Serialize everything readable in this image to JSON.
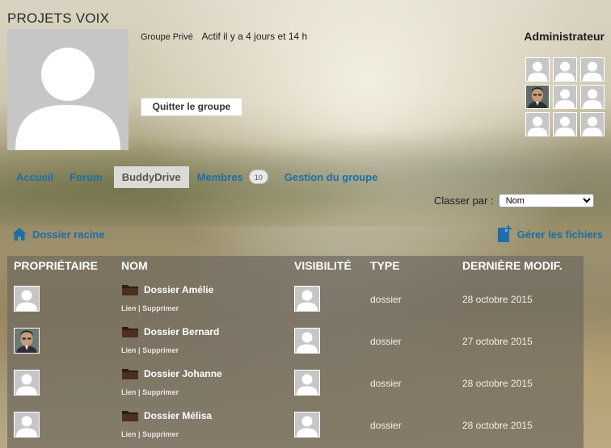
{
  "group": {
    "title": "PROJETS VOIX",
    "privacy": "Groupe Privé",
    "activity": "Actif il y a 4 jours et 14 h",
    "quit_label": "Quitter le groupe"
  },
  "admins": {
    "title": "Administrateur"
  },
  "nav": {
    "items": [
      {
        "label": "Accueil"
      },
      {
        "label": "Forum"
      },
      {
        "label": "BuddyDrive"
      },
      {
        "label": "Membres"
      },
      {
        "label": "Gestion du groupe"
      }
    ],
    "members_count": "10"
  },
  "sort": {
    "label": "Classer par :",
    "selected": "Nom"
  },
  "drive": {
    "root_label": "Dossier racine",
    "manage_label": "Gérer les fichiers"
  },
  "table": {
    "headers": {
      "owner": "PROPRIÉTAIRE",
      "name": "NOM",
      "visibility": "VISIBILITÉ",
      "type": "TYPE",
      "modified": "DERNIÈRE MODIF."
    },
    "action_link": "Lien",
    "action_sep": "|",
    "action_delete": "Supprimer",
    "rows": [
      {
        "name": "Dossier Amélie",
        "type": "dossier",
        "modified": "28 octobre 2015"
      },
      {
        "name": "Dossier Bernard",
        "type": "dossier",
        "modified": "27 octobre 2015"
      },
      {
        "name": "Dossier Johanne",
        "type": "dossier",
        "modified": "28 octobre 2015"
      },
      {
        "name": "Dossier Mélisa",
        "type": "dossier",
        "modified": "28 octobre 2015"
      }
    ]
  },
  "colors": {
    "link": "#1e6ea8",
    "table_bg": "#70695f"
  },
  "icons": {
    "home": "home-icon",
    "manage": "file-add-icon",
    "folder": "folder-icon",
    "avatar": "person-placeholder-icon"
  }
}
